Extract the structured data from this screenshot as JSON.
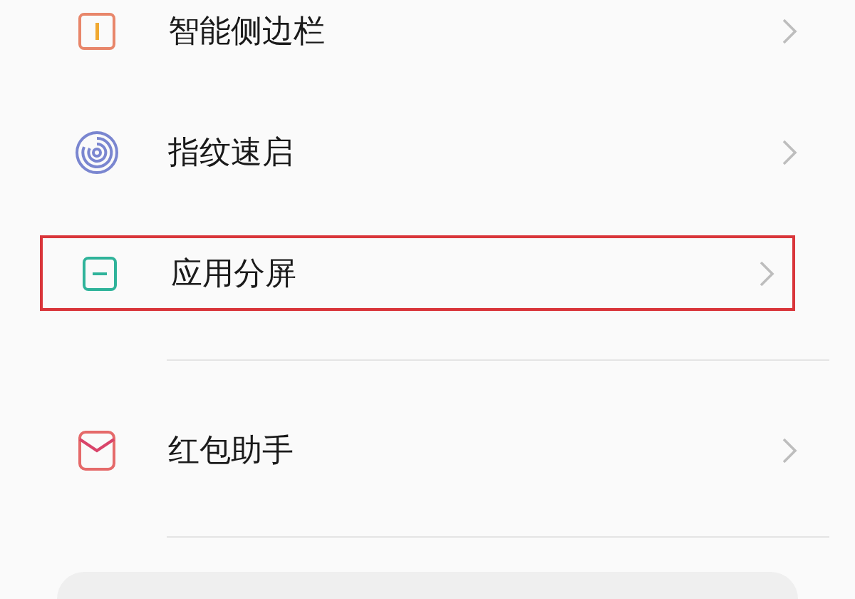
{
  "groups": [
    {
      "items": [
        {
          "kind": "sidebar",
          "label": "智能侧边栏",
          "highlighted": false
        },
        {
          "kind": "fingerprint",
          "label": "指纹速启",
          "highlighted": false
        },
        {
          "kind": "split",
          "label": "应用分屏",
          "highlighted": true
        }
      ]
    },
    {
      "items": [
        {
          "kind": "envelope",
          "label": "红包助手",
          "highlighted": false
        }
      ]
    }
  ]
}
